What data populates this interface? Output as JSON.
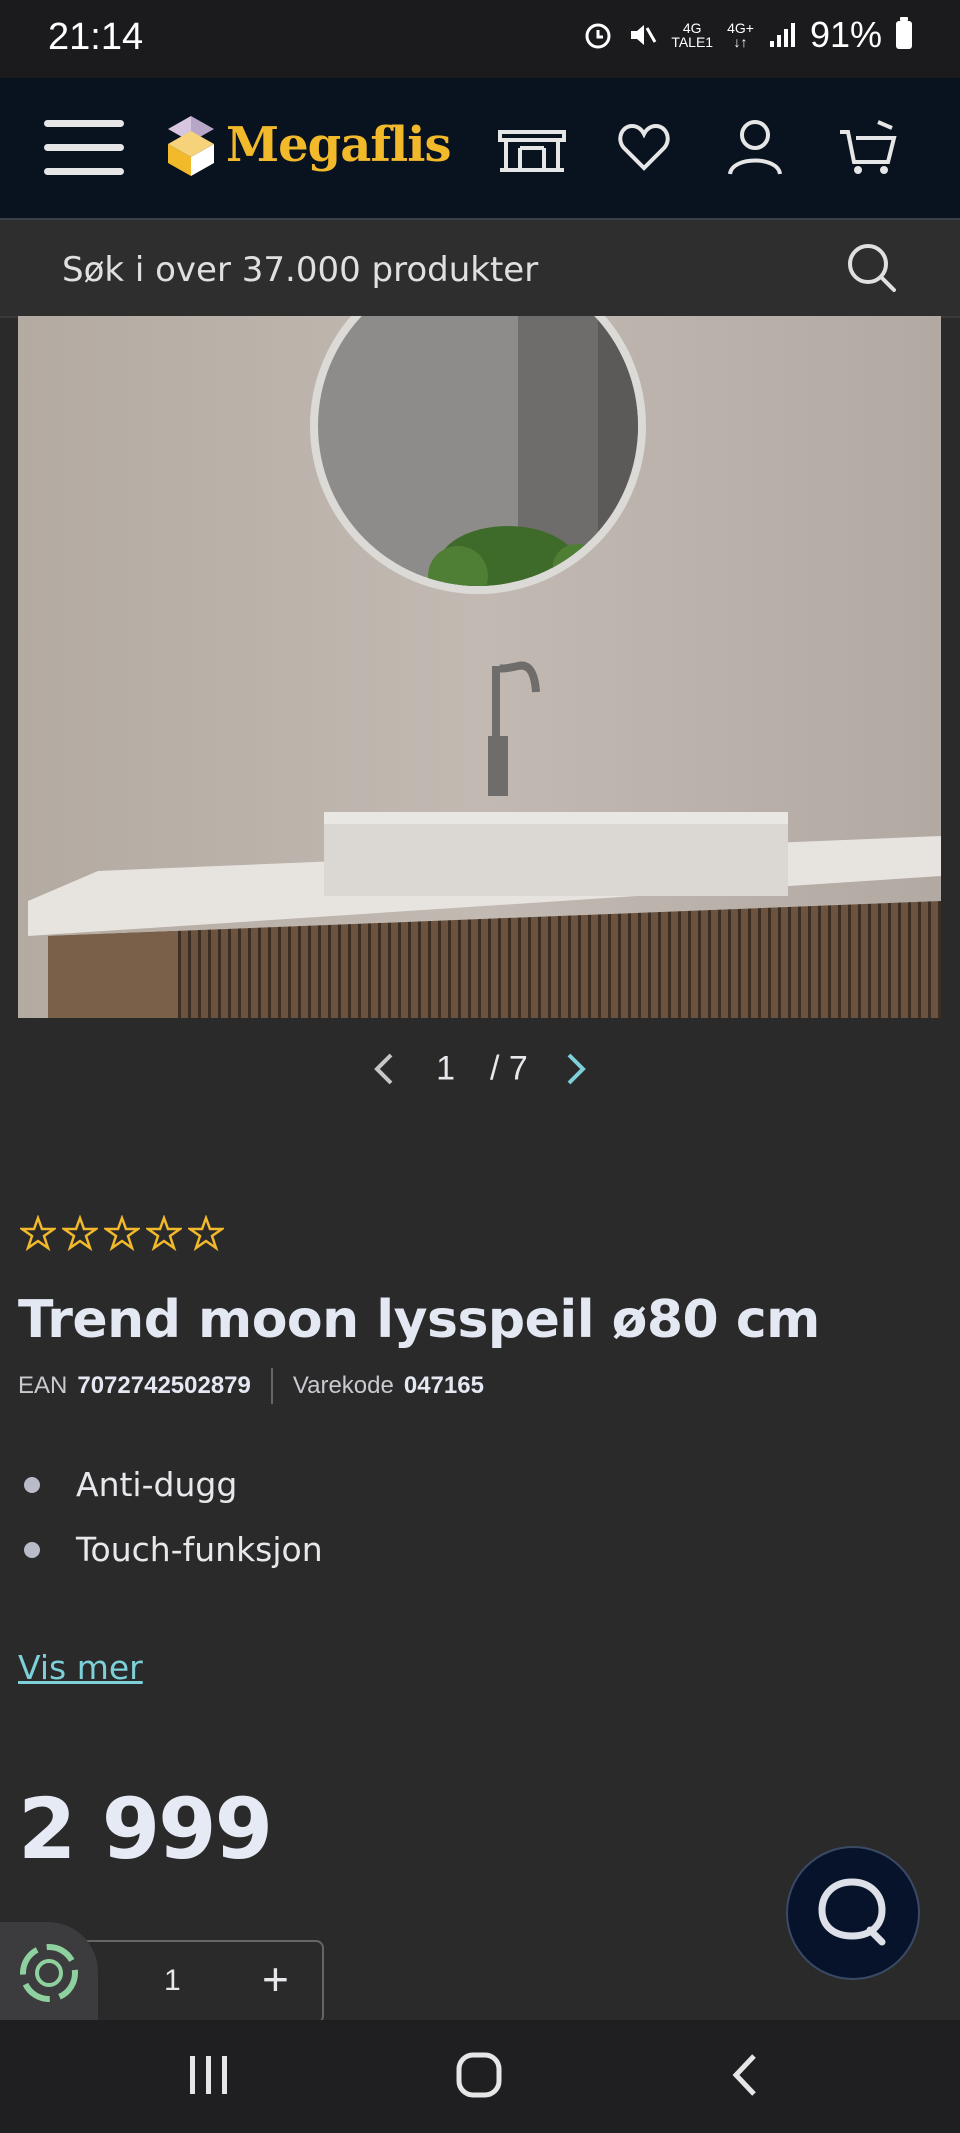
{
  "status_bar": {
    "time": "21:14",
    "network1": "4G",
    "network1_sub": "TALE1",
    "network2": "4G+",
    "battery": "91%"
  },
  "header": {
    "logo_text": "Megaflis",
    "brand_color": "#f2b92b",
    "icons": [
      "menu-icon",
      "showroom-icon",
      "heart-icon",
      "user-icon",
      "cart-icon"
    ]
  },
  "search": {
    "placeholder": "Søk i over 37.000 produkter"
  },
  "gallery": {
    "current": "1",
    "separator": "/",
    "total": "7"
  },
  "product": {
    "rating_stars": 0,
    "rating_max": 5,
    "title": "Trend moon lysspeil ø80 cm",
    "ean_label": "EAN",
    "ean_value": "7072742502879",
    "code_label": "Varekode",
    "code_value": "047165",
    "features": [
      "Anti-dugg",
      "Touch-funksjon"
    ],
    "more_link": "Vis mer",
    "price": "2 999",
    "quantity": "1",
    "plus": "+"
  },
  "colors": {
    "background": "#2a2a2a",
    "header": "#09121f",
    "accent_link": "#7dd0d8",
    "star": "#f2b92b"
  }
}
